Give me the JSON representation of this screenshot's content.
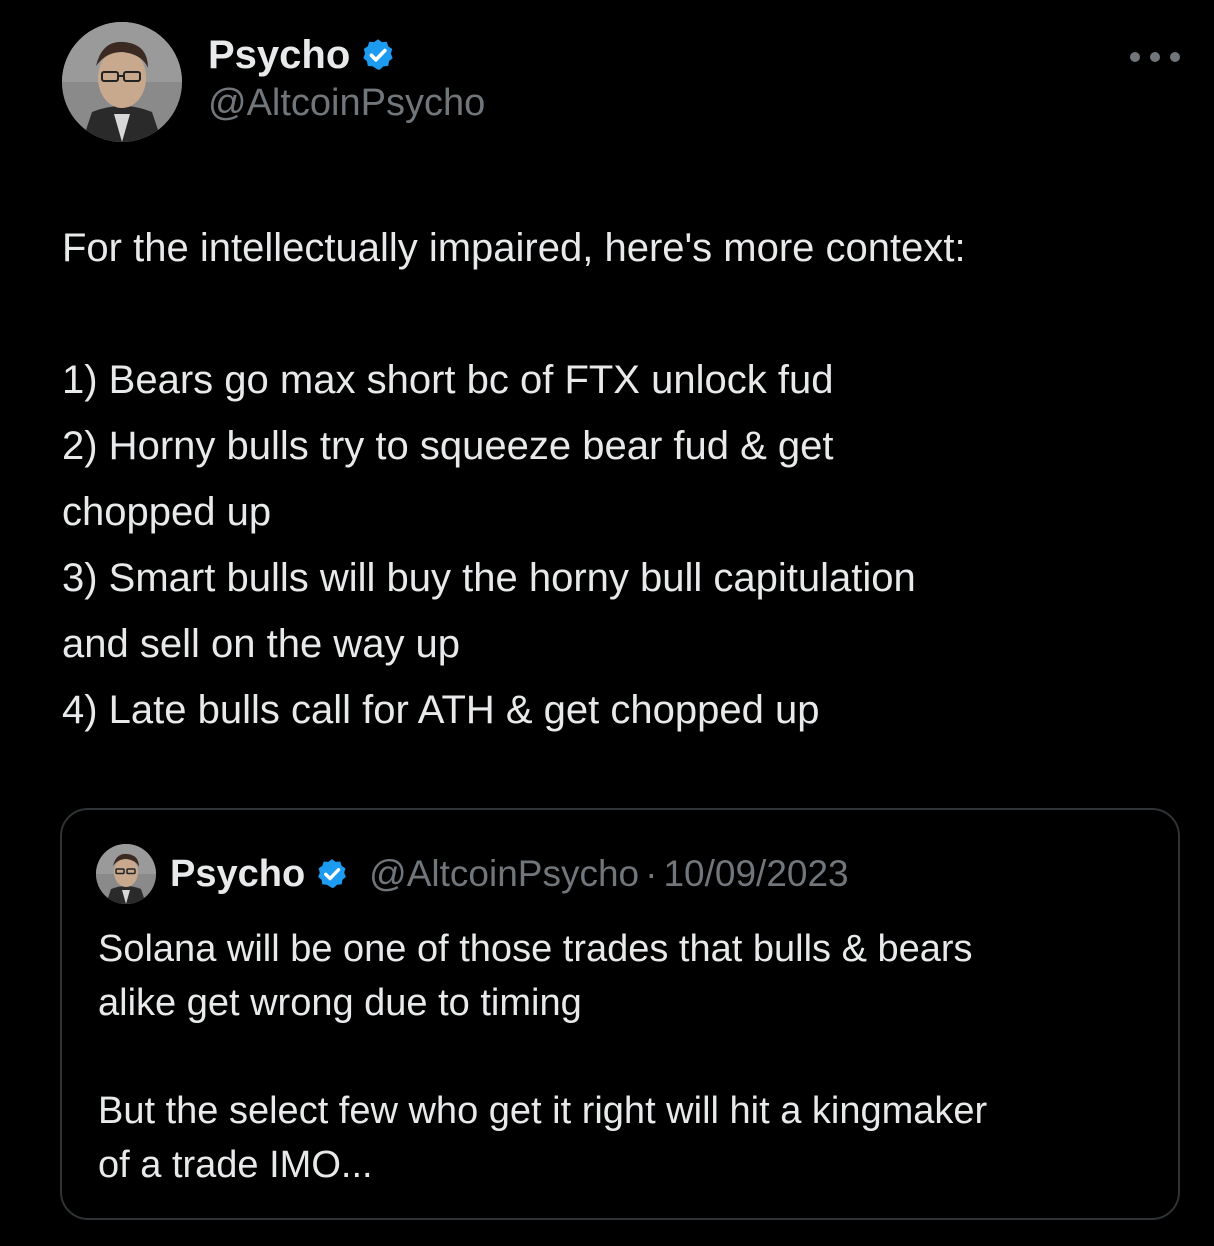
{
  "author": {
    "name": "Psycho",
    "handle": "@AltcoinPsycho",
    "verified_icon": "verified-badge-icon"
  },
  "menu_icon": "more-options-icon",
  "tweet": {
    "lines": [
      "For the intellectually impaired, here's more context:",
      "",
      "1) Bears go max short bc of FTX unlock fud",
      "2) Horny bulls try to squeeze bear fud & get",
      "chopped up",
      "3) Smart bulls will buy the horny bull capitulation",
      "and sell on the way up",
      "4) Late bulls call for ATH & get chopped up"
    ]
  },
  "quoted_tweet": {
    "name": "Psycho",
    "handle": "@AltcoinPsycho",
    "separator": "·",
    "date": "10/09/2023",
    "lines": [
      "Solana will be one of those trades that bulls & bears",
      "alike get wrong due to timing",
      "",
      "But the select few who get it right will hit a kingmaker",
      "of a trade IMO..."
    ]
  },
  "colors": {
    "background": "#000000",
    "text_primary": "#e7e9ea",
    "text_secondary": "#71767b",
    "verified_blue": "#1d9bf0",
    "border": "#2f3336"
  }
}
